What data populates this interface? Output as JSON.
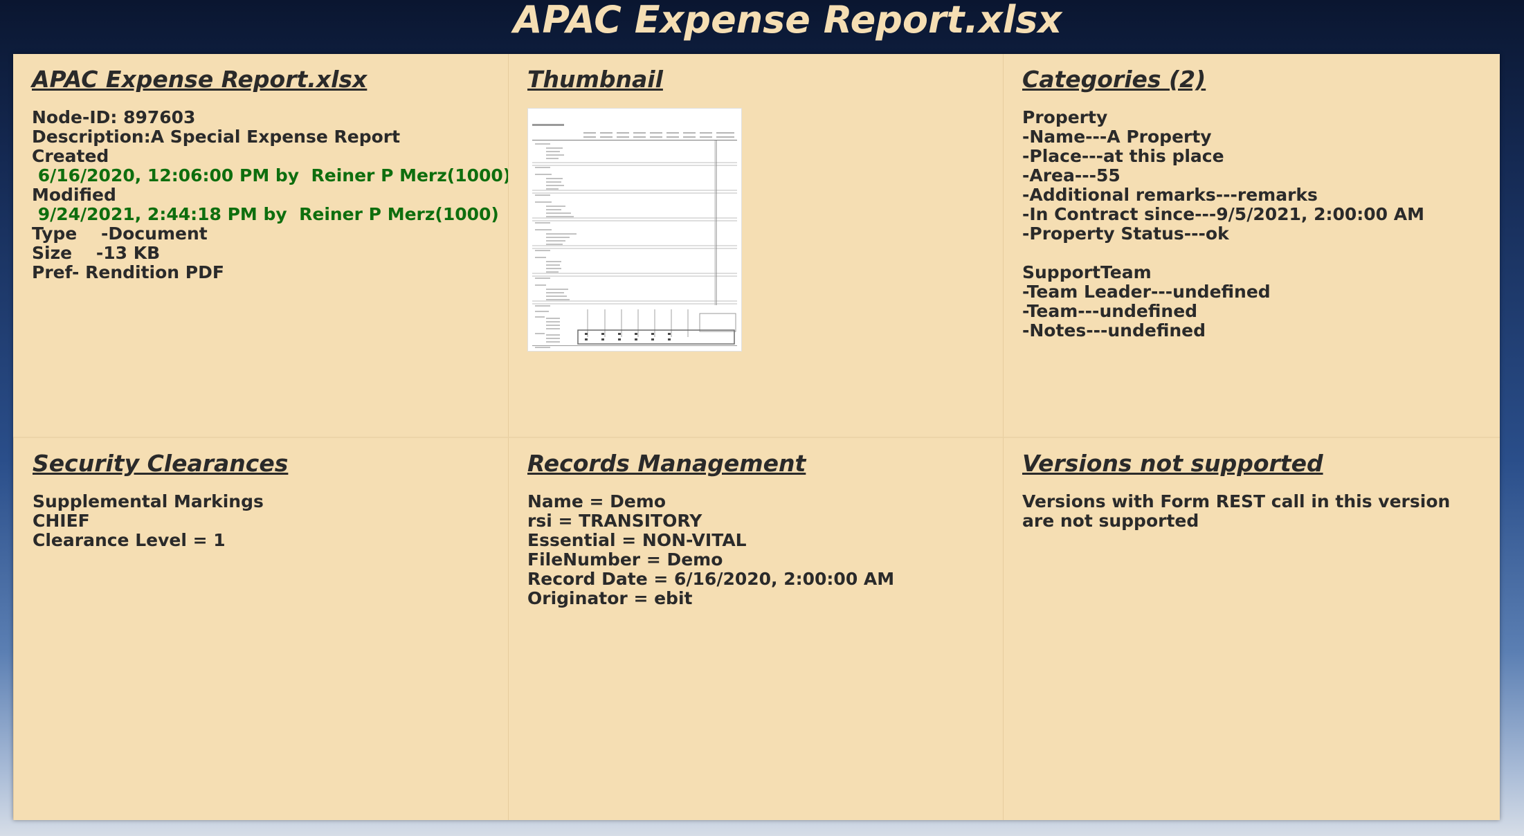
{
  "header": {
    "title": "APAC Expense Report.xlsx"
  },
  "panels": {
    "info": {
      "title": "APAC Expense Report.xlsx",
      "node_id": "Node-ID: 897603",
      "description": "Description:A Special Expense Report",
      "created_label": "Created",
      "created_value": " 6/16/2020, 12:06:00 PM by  Reiner P Merz(1000)",
      "modified_label": "Modified",
      "modified_value": " 9/24/2021, 2:44:18 PM by  Reiner P Merz(1000)",
      "type": "Type    -Document",
      "size": "Size    -13 KB",
      "pref": "Pref- Rendition PDF"
    },
    "thumbnail": {
      "title": "Thumbnail",
      "image_name": "spreadsheet-thumbnail"
    },
    "categories": {
      "title": "Categories (2)",
      "property": {
        "name": "Property",
        "lines": [
          "-Name---A Property",
          "-Place---at this place",
          "-Area---55",
          "-Additional remarks---remarks",
          "-In Contract since---9/5/2021, 2:00:00 AM",
          "-Property Status---ok"
        ]
      },
      "support_team": {
        "name": "SupportTeam",
        "lines": [
          "-Team Leader---undefined",
          "-Team---undefined",
          "-Notes---undefined"
        ]
      }
    },
    "security": {
      "title": "Security Clearances",
      "lines": [
        "Supplemental Markings",
        "CHIEF",
        "Clearance Level = 1"
      ]
    },
    "records": {
      "title": "Records Management",
      "lines": [
        "Name = Demo",
        "rsi = TRANSITORY",
        "Essential = NON-VITAL",
        "FileNumber = Demo",
        "Record Date = 6/16/2020, 2:00:00 AM",
        "Originator = ebit"
      ]
    },
    "versions": {
      "title": "Versions not supported",
      "message": "Versions with Form REST call in this version are not supported"
    }
  },
  "colors": {
    "panel_bg": "#f5deb3",
    "title_color": "#f5deb3",
    "green_text": "#0e6e0e",
    "text": "#2a2a2a"
  }
}
